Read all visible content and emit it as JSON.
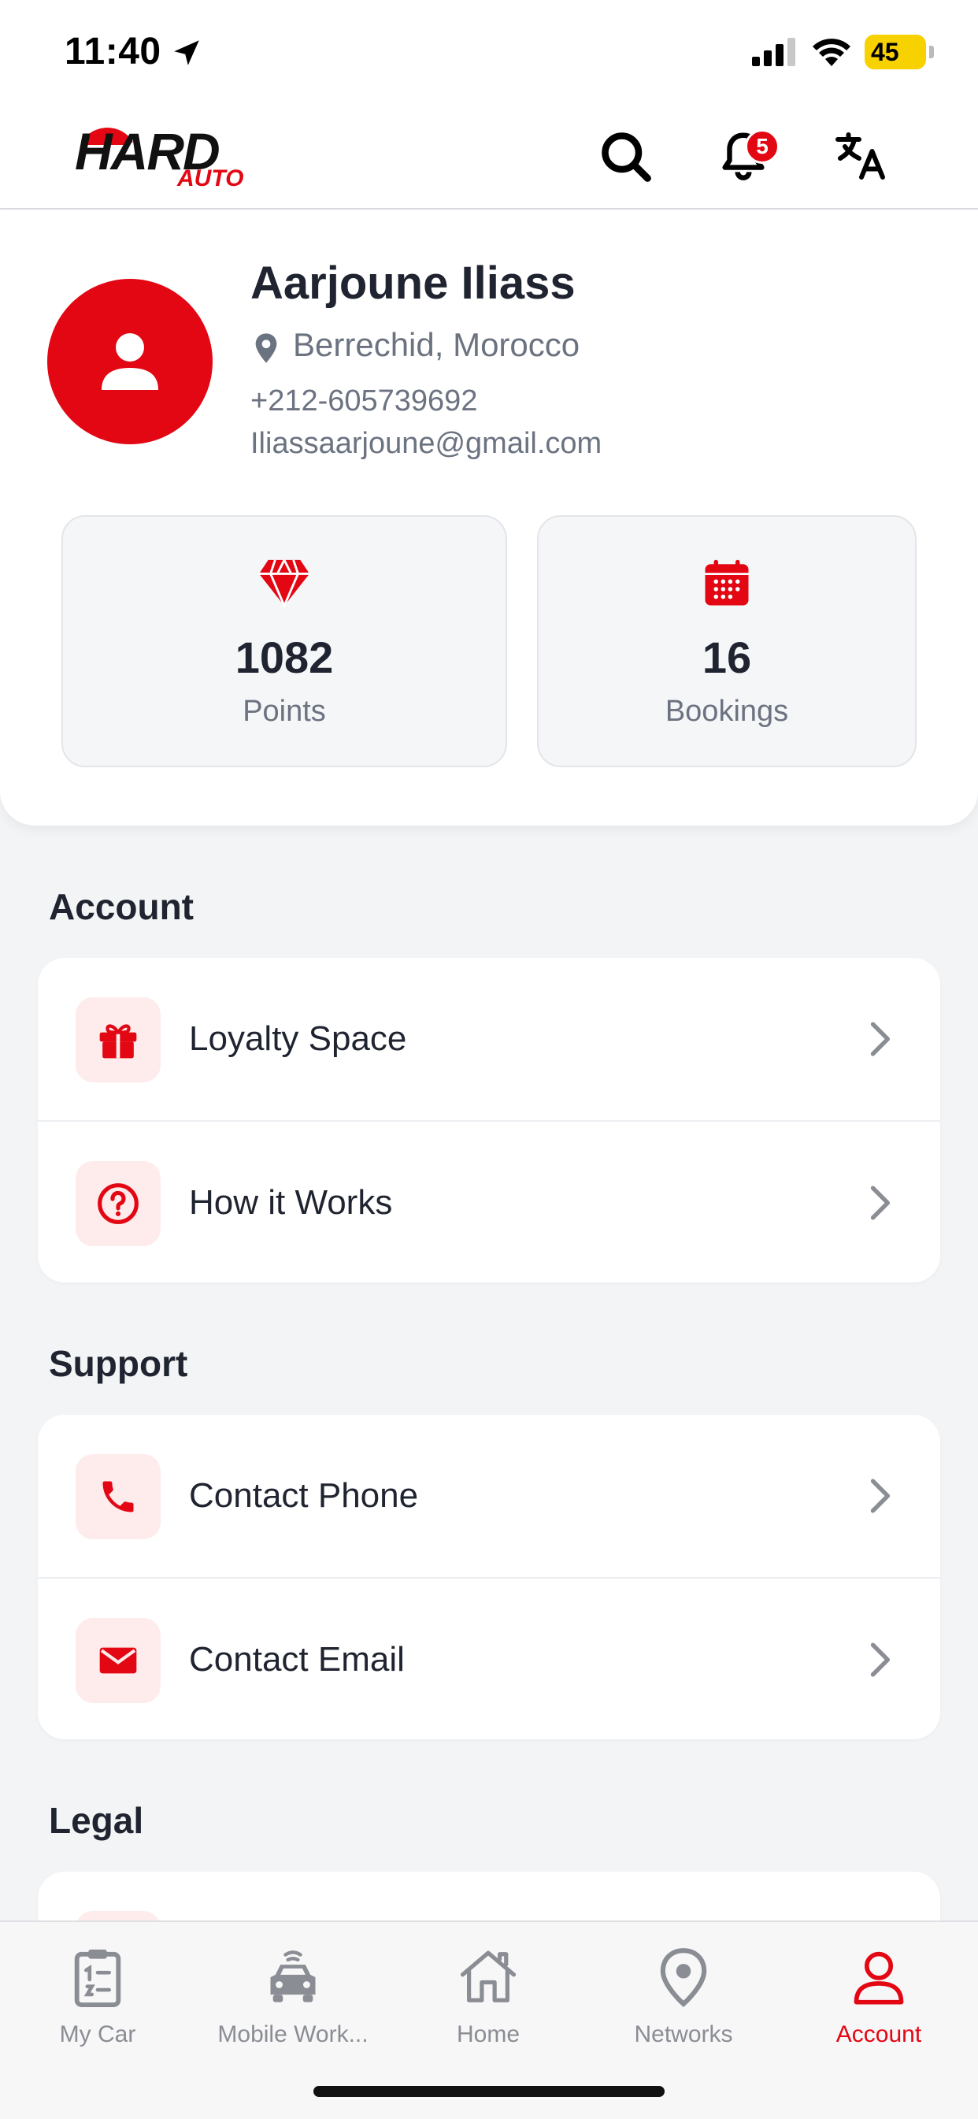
{
  "status_bar": {
    "time": "11:40",
    "battery": "45"
  },
  "header": {
    "logo_main": "HARD",
    "logo_sub": "AUTO",
    "notification_count": "5",
    "icons": [
      "search-icon",
      "bell-icon",
      "translate-icon"
    ]
  },
  "profile": {
    "name": "Aarjoune Iliass",
    "location": "Berrechid, Morocco",
    "phone": "+212-605739692",
    "email": "Iliassaarjoune@gmail.com",
    "stats": [
      {
        "value": "1082",
        "label": "Points",
        "icon": "diamond-icon"
      },
      {
        "value": "16",
        "label": "Bookings",
        "icon": "calendar-icon"
      }
    ]
  },
  "sections": {
    "account": {
      "title": "Account",
      "items": [
        {
          "label": "Loyalty Space",
          "icon": "gift-icon"
        },
        {
          "label": "How it Works",
          "icon": "question-icon"
        }
      ]
    },
    "support": {
      "title": "Support",
      "items": [
        {
          "label": "Contact Phone",
          "icon": "phone-icon"
        },
        {
          "label": "Contact Email",
          "icon": "mail-icon"
        }
      ]
    },
    "legal": {
      "title": "Legal"
    }
  },
  "tabbar": {
    "items": [
      {
        "label": "My Car",
        "icon": "clipboard-icon"
      },
      {
        "label": "Mobile Work...",
        "icon": "car-icon"
      },
      {
        "label": "Home",
        "icon": "home-icon"
      },
      {
        "label": "Networks",
        "icon": "map-pin-icon"
      },
      {
        "label": "Account",
        "icon": "user-icon",
        "active": true
      }
    ]
  },
  "colors": {
    "accent": "#e30613",
    "text": "#1f2430",
    "muted": "#6b7280",
    "background": "#f3f4f6"
  }
}
